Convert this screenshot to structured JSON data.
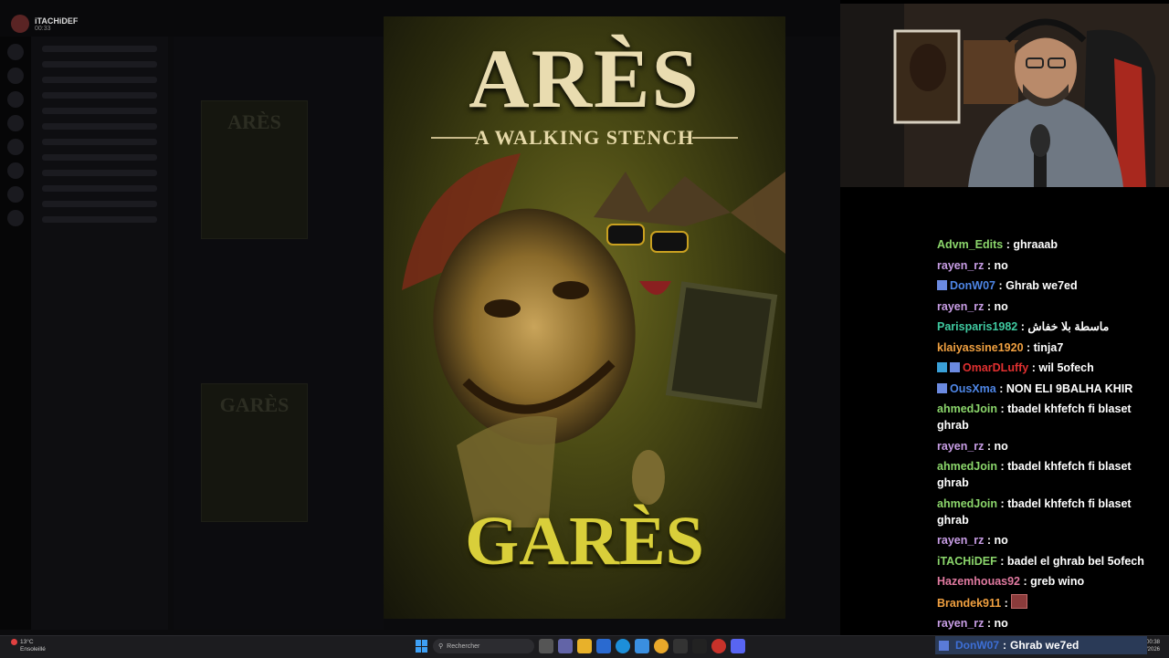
{
  "discord": {
    "user": "iTACHiDEF",
    "time": "00:33",
    "ghost_labels": [
      "ARÈS",
      "GARÈS"
    ]
  },
  "poster": {
    "title": "ARÈS",
    "subtitle": "A WALKING STENCH",
    "bottom_title": "GARÈS"
  },
  "chat": {
    "messages": [
      {
        "user": "Advm_Edits",
        "color": "#8bd66b",
        "text": "ghraaab",
        "badges": []
      },
      {
        "user": "rayen_rz",
        "color": "#c99ee6",
        "text": "no",
        "badges": []
      },
      {
        "user": "DonW07",
        "color": "#4e86e6",
        "text": "Ghrab we7ed",
        "badges": [
          "music-note-badge"
        ]
      },
      {
        "user": "rayen_rz",
        "color": "#c99ee6",
        "text": "no",
        "badges": []
      },
      {
        "user": "Parisparis1982",
        "color": "#3fc9a0",
        "text": "ماسطة بلا خفاش",
        "badges": []
      },
      {
        "user": "klaiyassine1920",
        "color": "#f0a040",
        "text": "tinja7",
        "badges": []
      },
      {
        "user": "OmarDLuffy",
        "color": "#e03030",
        "text": "wil 5ofech",
        "badges": [
          "cube-badge",
          "music-note-badge"
        ]
      },
      {
        "user": "OusXma",
        "color": "#4e86e6",
        "text": "NON ELI 9BALHA KHIR",
        "badges": [
          "music-note-badge"
        ]
      },
      {
        "user": "ahmedJoin",
        "color": "#8bd66b",
        "text": "tbadel khfefch fi blaset ghrab",
        "badges": []
      },
      {
        "user": "rayen_rz",
        "color": "#c99ee6",
        "text": "no",
        "badges": []
      },
      {
        "user": "ahmedJoin",
        "color": "#8bd66b",
        "text": "tbadel khfefch fi blaset ghrab",
        "badges": []
      },
      {
        "user": "ahmedJoin",
        "color": "#8bd66b",
        "text": "tbadel khfefch fi blaset ghrab",
        "badges": []
      },
      {
        "user": "rayen_rz",
        "color": "#c99ee6",
        "text": "no",
        "badges": []
      },
      {
        "user": "iTACHiDEF",
        "color": "#8bd66b",
        "text": "badel el ghrab bel 5ofech",
        "badges": []
      },
      {
        "user": "Hazemhouas92",
        "color": "#e07aa0",
        "text": "greb wino",
        "badges": []
      },
      {
        "user": "Brandek911",
        "color": "#f0a040",
        "text": "",
        "badges": [],
        "emote": "emote-icon"
      },
      {
        "user": "rayen_rz",
        "color": "#c99ee6",
        "text": "no",
        "badges": []
      }
    ]
  },
  "taskbar": {
    "weather_temp": "13°C",
    "weather_desc": "Ensoleillé",
    "search_placeholder": "Rechercher",
    "time": "00:38",
    "date": "18/01/2026",
    "ticker_user": "DonW07",
    "ticker_text": "Ghrab we7ed"
  }
}
